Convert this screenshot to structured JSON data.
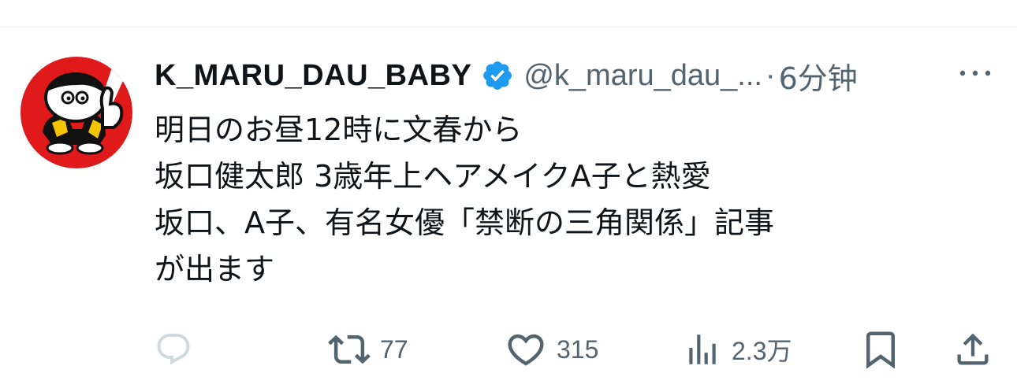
{
  "tweet": {
    "display_name": "K_MARU_DAU_BABY",
    "handle": "@k_maru_dau_...",
    "separator": "·",
    "time": "6分钟",
    "verified_icon": "verified-badge-icon",
    "text_lines": [
      "明日のお昼12時に文春から",
      "坂口健太郎 3歳年上ヘアメイクA子と熱愛",
      "坂口、A子、有名女優「禁断の三角関係」記事",
      "が出ます"
    ]
  },
  "actions": {
    "reply": {
      "icon": "reply-icon"
    },
    "retweet": {
      "icon": "retweet-icon",
      "count": "77"
    },
    "like": {
      "icon": "heart-icon",
      "count": "315"
    },
    "views": {
      "icon": "views-icon",
      "count": "2.3万"
    },
    "bookmark": {
      "icon": "bookmark-icon"
    },
    "share": {
      "icon": "share-icon"
    }
  },
  "colors": {
    "text": "#0f1419",
    "secondary": "#536471",
    "verified": "#1d9bf0",
    "avatar_background": "#e0191b",
    "reply_icon_faded": "#cfd9de"
  }
}
